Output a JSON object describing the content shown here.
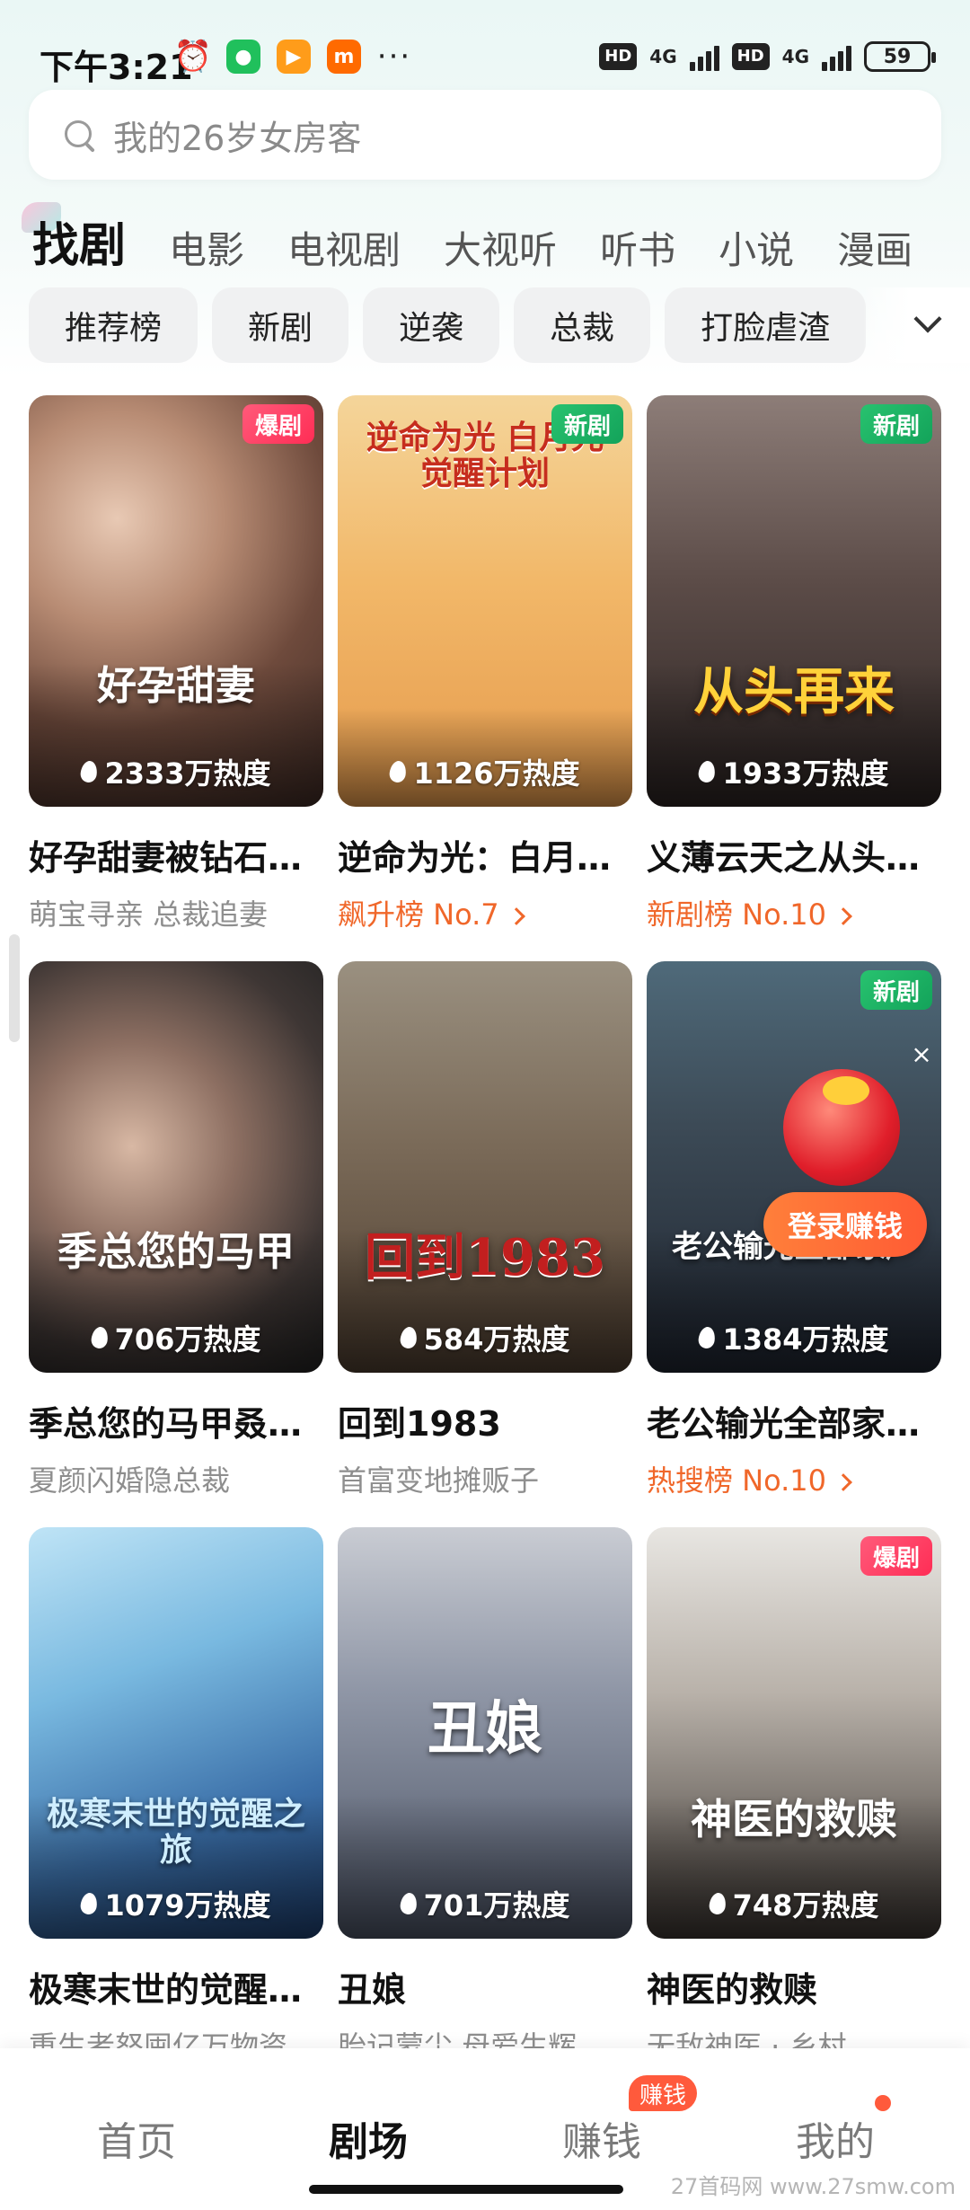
{
  "status_bar": {
    "time": "下午3:21",
    "battery": "59",
    "signal_1": "4G",
    "signal_2": "4G",
    "hd_1": "HD",
    "hd_2": "HD",
    "icons": [
      "alarm-icon",
      "wechat-icon",
      "video-app-icon",
      "mi-icon",
      "more-dots-icon"
    ]
  },
  "search": {
    "placeholder": "我的26岁女房客"
  },
  "tabs": [
    {
      "label": "找剧",
      "active": true
    },
    {
      "label": "电影"
    },
    {
      "label": "电视剧"
    },
    {
      "label": "大视听"
    },
    {
      "label": "听书"
    },
    {
      "label": "小说"
    },
    {
      "label": "漫画"
    }
  ],
  "chips": [
    "推荐榜",
    "新剧",
    "逆袭",
    "总裁",
    "打脸虐渣"
  ],
  "cards": [
    {
      "badge": "爆剧",
      "poster_title": "好孕甜妻",
      "heat": "2333万热度",
      "title": "好孕甜妻被钻石…",
      "sub": "萌宝寻亲 总裁追妻",
      "sub_is_rank": false
    },
    {
      "badge": "新剧",
      "poster_title": "逆命为光 白月光觉醒计划",
      "heat": "1126万热度",
      "title": "逆命为光：白月…",
      "sub": "飙升榜 No.7",
      "sub_is_rank": true
    },
    {
      "badge": "新剧",
      "poster_title": "从头再来",
      "heat": "1933万热度",
      "title": "义薄云天之从头…",
      "sub": "新剧榜 No.10",
      "sub_is_rank": true
    },
    {
      "badge": "",
      "poster_title": "季总您的马甲",
      "heat": "706万热度",
      "title": "季总您的马甲叒…",
      "sub": "夏颜闪婚隐总裁",
      "sub_is_rank": false
    },
    {
      "badge": "",
      "poster_title": "回到1983",
      "heat": "584万热度",
      "title": "回到1983",
      "sub": "首富变地摊贩子",
      "sub_is_rank": false
    },
    {
      "badge": "新剧",
      "poster_title": "老公输光全部家产",
      "heat": "1384万热度",
      "title": "老公输光全部家…",
      "sub": "热搜榜 No.10",
      "sub_is_rank": true,
      "promo": "登录赚钱"
    },
    {
      "badge": "",
      "poster_title": "极寒末世的觉醒之旅",
      "heat": "1079万热度",
      "title": "极寒末世的觉醒…",
      "sub": "重生者怒囤亿万物资",
      "sub_is_rank": false
    },
    {
      "badge": "",
      "poster_title": "丑娘",
      "heat": "701万热度",
      "title": "丑娘",
      "sub": "胎记蒙尘 母爱生辉",
      "sub_is_rank": false
    },
    {
      "badge": "爆剧",
      "poster_title": "神医的救赎",
      "heat": "748万热度",
      "title": "神医的救赎",
      "sub": "无敌神医 · 乡村",
      "sub_is_rank": false
    }
  ],
  "bottom_nav": {
    "items": [
      {
        "label": "首页"
      },
      {
        "label": "剧场",
        "active": true
      },
      {
        "label": "赚钱"
      },
      {
        "label": "我的"
      }
    ],
    "earn_badge": "赚钱"
  },
  "watermark": "27首码网 www.27smw.com",
  "colors": {
    "accent_orange": "#f0672a",
    "badge_hot": "#ff2d55",
    "badge_new": "#13a35a"
  }
}
